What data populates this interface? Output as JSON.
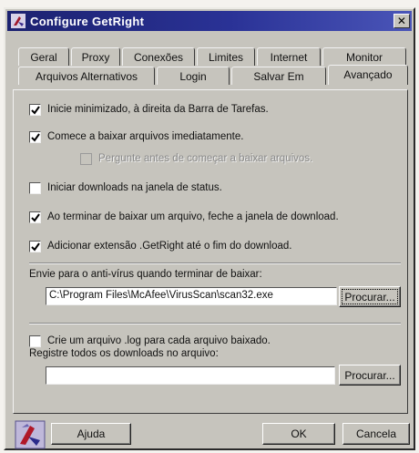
{
  "window": {
    "title": "Configure GetRight"
  },
  "tabs": {
    "row1": [
      "Geral",
      "Proxy",
      "Conexões",
      "Limites",
      "Internet",
      "Monitor"
    ],
    "row2": [
      "Arquivos Alternativos",
      "Login",
      "Salvar Em",
      "Avançado"
    ],
    "active": "Avançado"
  },
  "options": {
    "start_minimized": {
      "label": "Inicie minimizado, à direita da Barra de Tarefas.",
      "checked": true
    },
    "start_download_now": {
      "label": "Comece a baixar arquivos imediatamente.",
      "checked": true
    },
    "ask_before_download": {
      "label": "Pergunte antes de começar a baixar arquivos.",
      "checked": false,
      "enabled": false
    },
    "downloads_in_status": {
      "label": "Iniciar downloads na janela de status.",
      "checked": false
    },
    "close_on_finish": {
      "label": "Ao terminar de baixar um arquivo, feche a janela de download.",
      "checked": true
    },
    "add_extension": {
      "label": "Adicionar extensão .GetRight até o fim do download.",
      "checked": true
    }
  },
  "antivirus": {
    "label": "Envie para o anti-vírus quando terminar de baixar:",
    "path_value": "C:\\Program Files\\McAfee\\VirusScan\\scan32.exe",
    "browse_label": "Procurar..."
  },
  "log": {
    "create_log": {
      "label": "Crie um arquivo .log para cada arquivo baixado.",
      "checked": false
    },
    "register_label": "Registre todos os downloads no arquivo:",
    "file_value": "",
    "browse_label": "Procurar..."
  },
  "footer": {
    "help_label": "Ajuda",
    "ok_label": "OK",
    "cancel_label": "Cancela"
  },
  "colors": {
    "titlebar": "#1c2270",
    "face": "#c6c4bd",
    "check_mark": "#000000"
  },
  "icons": {
    "app": "getright-app-icon",
    "close": "close-icon",
    "help": "getright-help-icon"
  }
}
